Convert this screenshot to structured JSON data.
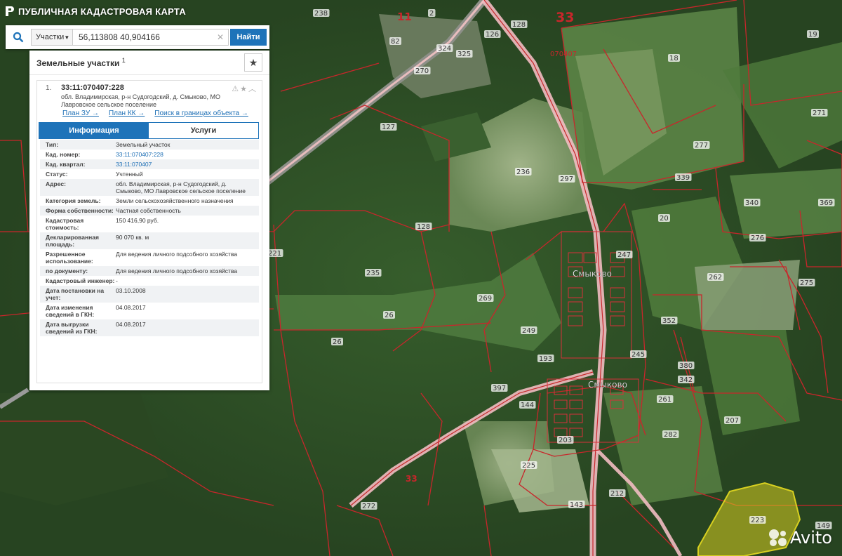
{
  "header": {
    "title": "ПУБЛИЧНАЯ КАДАСТРОВАЯ КАРТА"
  },
  "search": {
    "type_label": "Участки",
    "query": "56,113808 40,904166",
    "button_label": "Найти"
  },
  "panel": {
    "heading": "Земельные участки",
    "count": "1"
  },
  "card": {
    "index": "1.",
    "cad_number": "33:11:070407:228",
    "address": "обл. Владимирская, р-н Судогодский, д. Смыково, МО Лавровское сельское поселение",
    "links": [
      "План ЗУ →",
      "План КК →",
      "Поиск в границах объекта →"
    ],
    "tabs": [
      "Информация",
      "Услуги"
    ],
    "rows": [
      {
        "k": "Тип:",
        "v": "Земельный участок"
      },
      {
        "k": "Кад. номер:",
        "v": "33:11:070407:228"
      },
      {
        "k": "Кад. квартал:",
        "v": "33:11:070407"
      },
      {
        "k": "Статус:",
        "v": "Учтенный"
      },
      {
        "k": "Адрес:",
        "v": "обл. Владимирская, р-н Судогодский, д. Смыково, МО Лавровское сельское поселение"
      },
      {
        "k": "Категория земель:",
        "v": "Земли сельскохозяйственного назначения"
      },
      {
        "k": "Форма собственности:",
        "v": "Частная собственность"
      },
      {
        "k": "Кадастровая стоимость:",
        "v": "150 416,90 руб."
      },
      {
        "k": "Декларированная площадь:",
        "v": "90 070 кв. м"
      },
      {
        "k": "Разрешенное использование:",
        "v": "Для ведения личного подсобного хозяйства"
      },
      {
        "k": "по документу:",
        "v": "Для ведения личного подсобного хозяйства"
      },
      {
        "k": "Кадастровый инженер:",
        "v": "-"
      },
      {
        "k": "Дата постановки на учет:",
        "v": "03.10.2008"
      },
      {
        "k": "Дата изменения сведений в ГКН:",
        "v": "04.08.2017"
      },
      {
        "k": "Дата выгрузки сведений из ГКН:",
        "v": "04.08.2017"
      }
    ]
  },
  "map": {
    "village_labels": [
      "Смыково",
      "Смыково"
    ],
    "big_labels": [
      "11",
      "33",
      "33"
    ],
    "quarter_labels": [
      "070407"
    ],
    "parcel_labels": [
      "238",
      "2",
      "82",
      "324",
      "325",
      "270",
      "126",
      "128",
      "18",
      "19",
      "271",
      "127",
      "236",
      "297",
      "277",
      "339",
      "340",
      "369",
      "128",
      "20",
      "247",
      "235",
      "269",
      "221",
      "26",
      "262",
      "275",
      "276",
      "352",
      "26",
      "249",
      "193",
      "245",
      "380",
      "342",
      "397",
      "144",
      "207",
      "261",
      "282",
      "225",
      "143",
      "203",
      "272",
      "149",
      "223",
      "212"
    ],
    "colors": {
      "boundary": "#c8262b",
      "road": "#ffd1d6",
      "highlight": "#d8d020"
    }
  },
  "watermark": {
    "text": "Avito"
  }
}
